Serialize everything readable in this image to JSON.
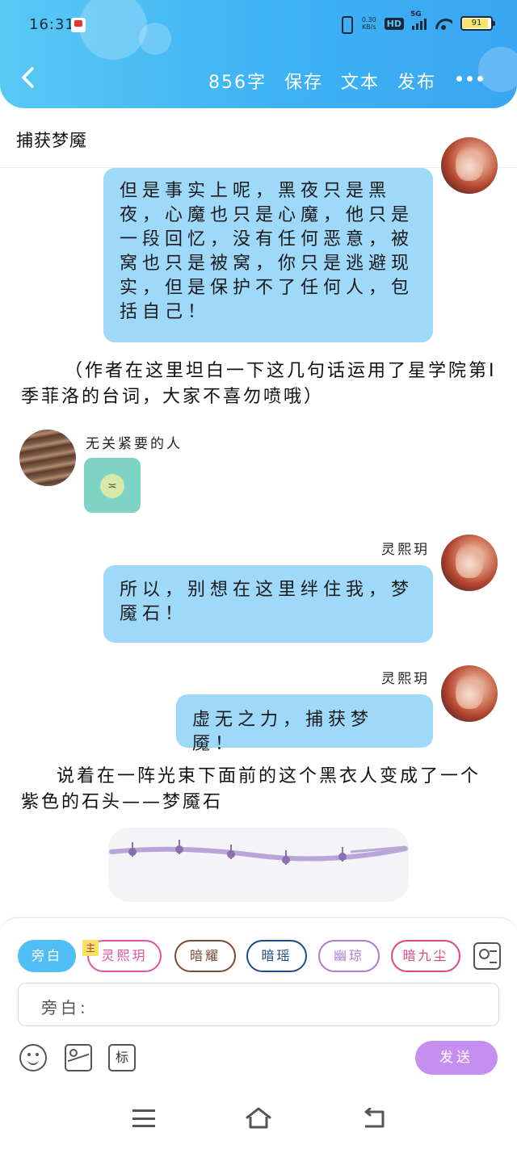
{
  "status_bar": {
    "time": "16:31",
    "net_speed_top": "0.30",
    "net_speed_bottom": "KB/s",
    "hd": "HD",
    "signal": "5G",
    "battery": "91"
  },
  "nav": {
    "word_count": "856字",
    "save": "保存",
    "text": "文本",
    "publish": "发布"
  },
  "document": {
    "title": "捕获梦魇"
  },
  "messages": [
    {
      "text": "但是事实上呢，黑夜只是黑夜，心魔也只是心魔，他只是一段回忆，没有任何恶意，被窝也只是被窝，你只是逃避现实，但是保护不了任何人，包括自己！"
    },
    {
      "narration": "（作者在这里坦白一下这几句话运用了星学院第Ⅰ季菲洛的台词，大家不喜勿喷哦）"
    },
    {
      "speaker": "无关紧要的人"
    },
    {
      "speaker": "灵熙玥",
      "text": "所以，别想在这里绊住我，梦魇石！"
    },
    {
      "speaker": "灵熙玥",
      "text": "虚无之力，捕获梦魇！"
    },
    {
      "narration": "说着在一阵光束下面前的这个黑衣人变成了一个紫色的石头——梦魇石"
    }
  ],
  "composer": {
    "chips": [
      {
        "label": "旁白",
        "color": "#4fbef5"
      },
      {
        "label": "灵熙玥",
        "color": "#e0559a"
      },
      {
        "label": "暗耀",
        "color": "#7a4a32"
      },
      {
        "label": "暗瑶",
        "color": "#1d4a8a"
      },
      {
        "label": "幽琼",
        "color": "#b07ad0"
      },
      {
        "label": "暗九尘",
        "color": "#e0457f"
      }
    ],
    "main_badge": "主",
    "input_prompt": "旁白:",
    "tag_button": "标",
    "send": "发送"
  }
}
